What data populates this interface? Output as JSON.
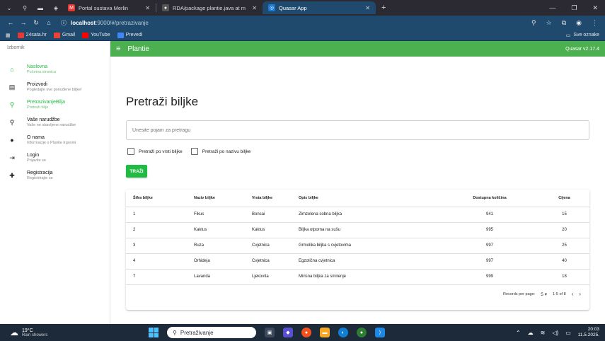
{
  "browser": {
    "tabs": [
      {
        "label": "Portal sustava Merlin",
        "active": false,
        "favicon_color": "#e53935"
      },
      {
        "label": "RDA/package plantie.java at m",
        "active": false,
        "favicon_color": "#555555"
      },
      {
        "label": "Quasar App",
        "active": true,
        "favicon_color": "#1976d2"
      }
    ],
    "url_host": "localhost",
    "url_path": ":9000/#/pretrazivanje",
    "bookmarks": [
      {
        "label": "24sata.hr",
        "color": "#e53935"
      },
      {
        "label": "Gmail",
        "color": "#ea4335"
      },
      {
        "label": "YouTube",
        "color": "#ff0000"
      },
      {
        "label": "Prevedi",
        "color": "#4285f4"
      }
    ],
    "bookmarks_folder": "Sve oznake"
  },
  "drawer": {
    "header": "Izbornik",
    "items": [
      {
        "title": "Naslovna",
        "caption": "Početna stranica",
        "icon": "home-icon",
        "glyph": "⌂",
        "active": true
      },
      {
        "title": "Proizvodi",
        "caption": "Pogledajte sve ponuđene biljke!",
        "icon": "book-icon",
        "glyph": "▤",
        "active": false
      },
      {
        "title": "PretrazivanjeBilja",
        "caption": "Pretraži bilje",
        "icon": "search-icon",
        "glyph": "⚲",
        "active": true
      },
      {
        "title": "Vaše narudžbe",
        "caption": "Vaše ne obavljene narudžbe",
        "icon": "search-icon",
        "glyph": "⚲",
        "active": false
      },
      {
        "title": "O nama",
        "caption": "Informacije o Plantie trgovini",
        "icon": "info-icon",
        "glyph": "●",
        "active": false
      },
      {
        "title": "Login",
        "caption": "Prijavite se",
        "icon": "login-icon",
        "glyph": "⇥",
        "active": false
      },
      {
        "title": "Registracija",
        "caption": "Registrirajte se",
        "icon": "person-add-icon",
        "glyph": "✚",
        "active": false
      }
    ]
  },
  "header": {
    "title": "Plantie",
    "version": "Quasar v2.17.4"
  },
  "page": {
    "title": "Pretraži biljke",
    "search_placeholder": "Unesite pojam za pretragu",
    "check_type": "Pretraži po vrsti biljke",
    "check_name": "Pretraži po nazivu biljke",
    "search_button": "TRAŽI"
  },
  "table": {
    "columns": [
      "Šifra biljke",
      "Naziv biljke",
      "Vrsta biljke",
      "Opis biljke",
      "Dostupna količina",
      "Cijena"
    ],
    "rows": [
      [
        "1",
        "Fikus",
        "Bonsai",
        "Zimzelena sobna biljka",
        "941",
        "15"
      ],
      [
        "2",
        "Kaktus",
        "Kaktus",
        "Biljka otporna na sušu",
        "995",
        "20"
      ],
      [
        "3",
        "Ruza",
        "Cvjetnica",
        "Grmolika biljka s cvjetovima",
        "997",
        "25"
      ],
      [
        "4",
        "Orhideja",
        "Cvjetnica",
        "Egzotična cvjetnica",
        "997",
        "40"
      ],
      [
        "7",
        "Lavanda",
        "Ljekovita",
        "Mirisna biljka za smirenje",
        "999",
        "18"
      ]
    ],
    "records_per_page_label": "Records per page:",
    "records_per_page": "5",
    "range": "1-5 of 8"
  },
  "taskbar": {
    "temperature": "19°C",
    "weather": "Rain showers",
    "search_placeholder": "Pretraživanje",
    "time": "20:03",
    "date": "11.5.2025."
  }
}
